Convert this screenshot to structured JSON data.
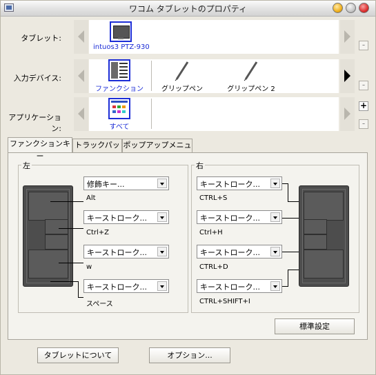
{
  "window": {
    "title": "ワコム タブレットのプロパティ"
  },
  "rows": {
    "tablet": {
      "label": "タブレット:",
      "item": "intuos3 PTZ-930"
    },
    "input_device": {
      "label": "入力デバイス:",
      "items": [
        "ファンクション",
        "グリップペン",
        "グリップペン 2"
      ]
    },
    "application": {
      "label": "アプリケーション:",
      "item": "すべて"
    }
  },
  "side_buttons": {
    "minus": "-",
    "plus": "+"
  },
  "tabs": [
    "ファンクションキー",
    "トラックパッド",
    "ポップアップメニュー"
  ],
  "left": {
    "title": "左",
    "keys": [
      {
        "selection": "修飾キー...",
        "value": "Alt"
      },
      {
        "selection": "キーストローク...",
        "value": "Ctrl+Z"
      },
      {
        "selection": "キーストローク...",
        "value": "w"
      },
      {
        "selection": "キーストローク...",
        "value": "スペース"
      }
    ]
  },
  "right": {
    "title": "右",
    "keys": [
      {
        "selection": "キーストローク...",
        "value": "CTRL+S"
      },
      {
        "selection": "キーストローク...",
        "value": "Ctrl+H"
      },
      {
        "selection": "キーストローク...",
        "value": "CTRL+D"
      },
      {
        "selection": "キーストローク...",
        "value": "CTRL+SHIFT+I"
      }
    ]
  },
  "buttons": {
    "defaults": "標準設定",
    "about": "タブレットについて",
    "options": "オプション..."
  },
  "colors": {
    "selection": "#1c2dd6",
    "window_bg": "#ece9e0",
    "panel_bg": "#f4f3ee"
  },
  "icons": [
    "tablet-icon",
    "function-keys-icon",
    "grip-pen-icon",
    "grip-pen-2-icon",
    "all-apps-icon"
  ]
}
